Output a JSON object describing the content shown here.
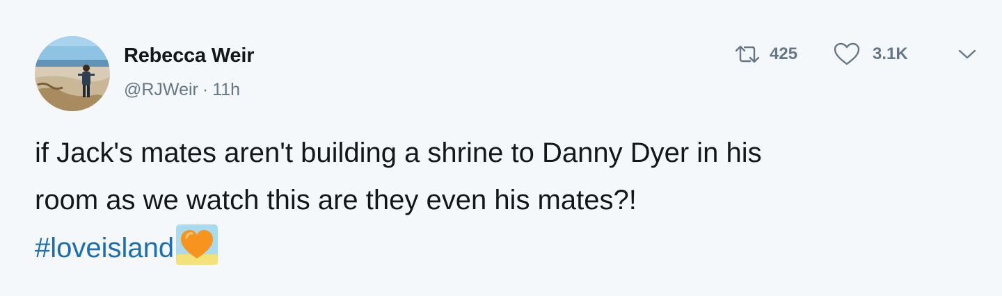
{
  "author": {
    "display_name": "Rebecca Weir",
    "handle": "@RJWeir",
    "separator": "·",
    "timestamp": "11h"
  },
  "actions": {
    "retweet_count": "425",
    "like_count": "3.1K",
    "retweet_icon": "retweet-icon",
    "like_icon": "heart-icon",
    "more_icon": "chevron-down-icon"
  },
  "tweet": {
    "line1": "if Jack's mates aren't building a shrine to Danny Dyer in his",
    "line2": "room as we watch this are they even his mates?!",
    "hashtag": "#loveisland",
    "emoji": "orange-heart-emoji"
  },
  "colors": {
    "background": "#f5f8fa",
    "text": "#14171a",
    "secondary": "#657786",
    "link": "#1b6eb0"
  }
}
